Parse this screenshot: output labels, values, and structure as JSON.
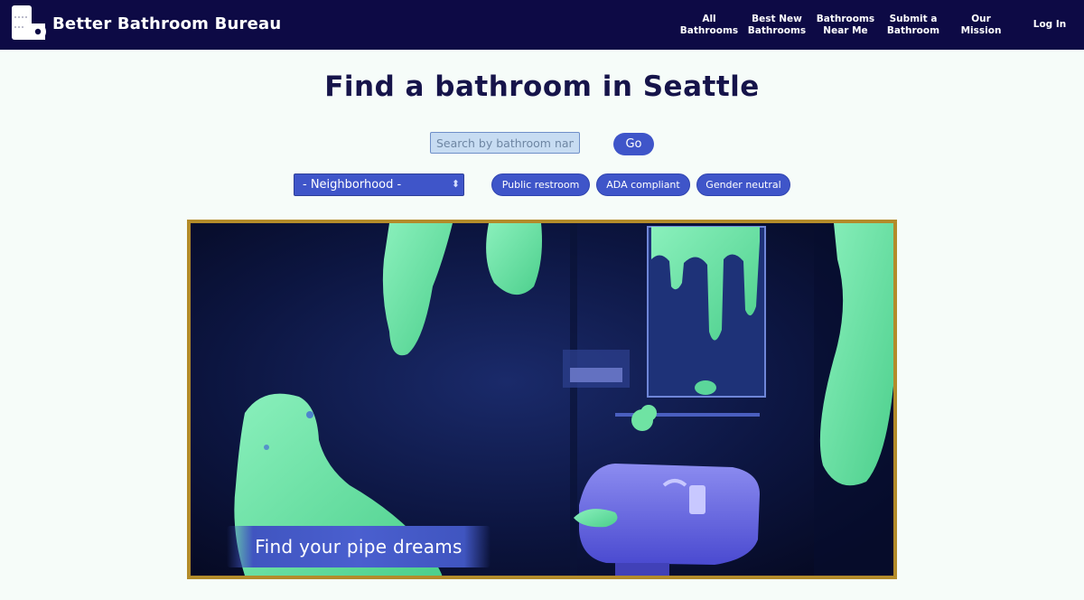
{
  "brand": {
    "name": "Better Bathroom Bureau",
    "logo_icon": "toilet-paper-icon"
  },
  "nav": [
    {
      "label": "All\nBathrooms"
    },
    {
      "label": "Best New\nBathrooms"
    },
    {
      "label": "Bathrooms\nNear Me"
    },
    {
      "label": "Submit a\nBathroom"
    },
    {
      "label": "Our\nMission"
    },
    {
      "label": "Log In"
    }
  ],
  "page": {
    "title": "Find a bathroom in Seattle"
  },
  "search": {
    "placeholder": "Search by bathroom name",
    "value": "",
    "go_label": "Go"
  },
  "filters": {
    "neighborhood_selected": "- Neighborhood -",
    "chips": [
      "Public restroom",
      "ADA compliant",
      "Gender neutral"
    ]
  },
  "hero": {
    "cta_label": "Find your pipe dreams"
  },
  "colors": {
    "nav_bg": "#0d0a45",
    "accent": "#3f55c9",
    "page_bg": "#f6fcf9",
    "frame_gold": "#b38b2a",
    "slime_green": "#6fe3a3"
  }
}
